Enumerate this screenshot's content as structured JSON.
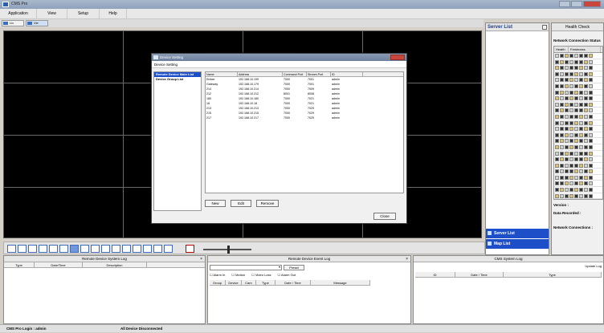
{
  "window": {
    "title": "CMS Pro"
  },
  "menu": [
    "Application",
    "View",
    "Setup",
    "Help"
  ],
  "tabs": [
    {
      "label": "Liv"
    },
    {
      "label": "Vie"
    }
  ],
  "server_list": {
    "title": "Server List",
    "panels": [
      "Server List",
      "Map List"
    ]
  },
  "health_check": {
    "title": "Health Check",
    "network_status_label": "Network Connection Status",
    "columns": [
      "Health",
      "Freshness"
    ],
    "version_label": "Version :",
    "data_recorded_label": "Data Recorded :",
    "network_connections_label": "Network Connections :"
  },
  "dialog": {
    "title": "Device Setting",
    "strip": "Device Setting",
    "tree": [
      "Remote Device Main List",
      "Device Group List"
    ],
    "columns": [
      "Name",
      "Address",
      "Command Port",
      "Stream Port",
      "ID"
    ],
    "rows": [
      [
        "Ember",
        "192.168.10.199",
        "7000",
        "7001",
        "admin"
      ],
      [
        "Gateway",
        "192.168.10.179",
        "7000",
        "7001",
        "admin"
      ],
      [
        "214",
        "192.168.10.214",
        "7000",
        "7009",
        "admin"
      ],
      [
        "212",
        "192.168.10.212",
        "8001",
        "8008",
        "admin"
      ],
      [
        "180",
        "192.168.10.180",
        "7000",
        "7021",
        "admin"
      ],
      [
        "18",
        "192.168.10.18",
        "7000",
        "7021",
        "admin"
      ],
      [
        "213",
        "192.168.10.213",
        "7000",
        "7029",
        "admin"
      ],
      [
        "215",
        "192.168.10.215",
        "7000",
        "7029",
        "admin"
      ],
      [
        "217",
        "192.168.10.217",
        "7000",
        "7029",
        "admin"
      ]
    ],
    "buttons": {
      "new": "New",
      "edit": "Edit",
      "remove": "Remove",
      "close": "Close"
    }
  },
  "logs": {
    "remote_system": {
      "title": "Remote Device System Log",
      "columns": [
        "Type",
        "Date/Time",
        "Description"
      ]
    },
    "remote_event": {
      "title": "Remote Device Event Log",
      "preset": "Preset",
      "checks": [
        "Alarm In",
        "Motion",
        "Video Loss",
        "Alarm Out"
      ],
      "columns": [
        "Group",
        "Device",
        "Cam",
        "Type",
        "Date / Time",
        "Message"
      ]
    },
    "cms_system": {
      "title": "CMS System Log",
      "extra": "Update Log",
      "columns": [
        "ID",
        "Date / Time",
        "Type"
      ]
    }
  },
  "status": {
    "login": "CMS Pro Login : admin",
    "device": "All Device Disconnected"
  }
}
